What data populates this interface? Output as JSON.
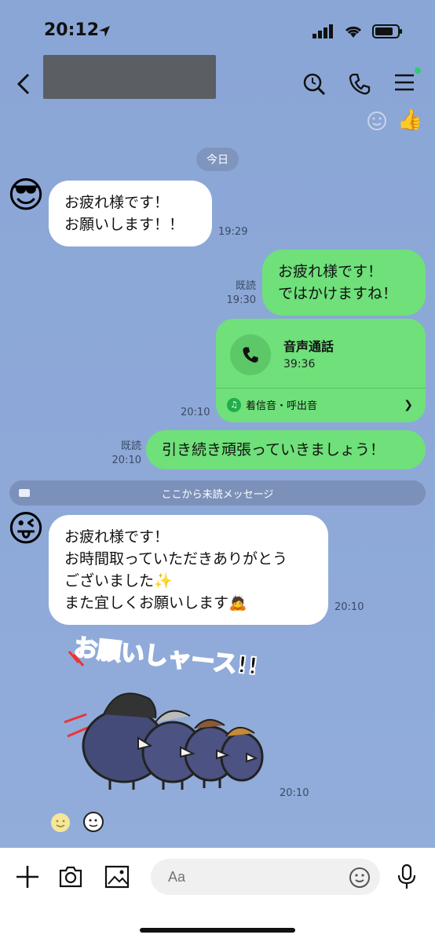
{
  "status": {
    "time": "20:12"
  },
  "header": {
    "title": "",
    "icons": [
      "back-arrow-icon",
      "search-clock-icon",
      "phone-icon",
      "menu-icon"
    ]
  },
  "date_divider": "今日",
  "messages": [
    {
      "side": "left",
      "text_lines": [
        "お疲れ様です！",
        "お願いします！！"
      ],
      "time": "19:29"
    },
    {
      "side": "right",
      "text_lines": [
        "お疲れ様です！",
        "ではかけますね！"
      ],
      "read": "既読",
      "time": "19:30"
    },
    {
      "side": "right",
      "type": "call",
      "title": "音声通話",
      "duration": "39:36",
      "footer": "着信音・呼出音",
      "time": "20:10"
    },
    {
      "side": "right",
      "text_lines": [
        "引き続き頑張っていきましょう！"
      ],
      "read": "既読",
      "time": "20:10"
    },
    {
      "side": "left",
      "text_lines": [
        "お疲れ様です！",
        "お時間取っていただきありがとう",
        "ございました✨",
        "また宜しくお願いします🙇"
      ],
      "time": "20:10"
    },
    {
      "side": "left",
      "type": "sticker",
      "sticker_text": "お願いしャース!!",
      "time": "20:10"
    }
  ],
  "unread_divider": "ここから未読メッセージ",
  "input": {
    "placeholder": "Aa"
  },
  "colors": {
    "green_bubble": "#6fe07a",
    "background": "#8ea9d8"
  }
}
